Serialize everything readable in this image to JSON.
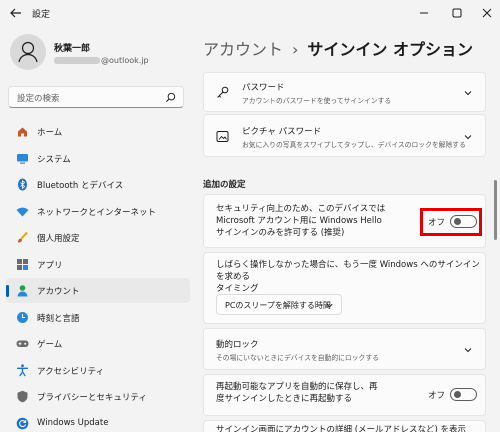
{
  "app": {
    "title": "設定"
  },
  "profile": {
    "name": "秋葉一郎",
    "email_domain": "@outlook.jp"
  },
  "search": {
    "placeholder": "設定の検索"
  },
  "nav": [
    {
      "label": "ホーム",
      "icon": "home-icon"
    },
    {
      "label": "システム",
      "icon": "system-icon"
    },
    {
      "label": "Bluetooth とデバイス",
      "icon": "bluetooth-icon"
    },
    {
      "label": "ネットワークとインターネット",
      "icon": "wifi-icon"
    },
    {
      "label": "個人用設定",
      "icon": "brush-icon"
    },
    {
      "label": "アプリ",
      "icon": "apps-icon"
    },
    {
      "label": "アカウント",
      "icon": "account-icon",
      "selected": true
    },
    {
      "label": "時刻と言語",
      "icon": "clock-globe-icon"
    },
    {
      "label": "ゲーム",
      "icon": "gamepad-icon"
    },
    {
      "label": "アクセシビリティ",
      "icon": "accessibility-icon"
    },
    {
      "label": "プライバシーとセキュリティ",
      "icon": "shield-icon"
    },
    {
      "label": "Windows Update",
      "icon": "update-icon"
    }
  ],
  "breadcrumb": {
    "parent": "アカウント",
    "separator": "›",
    "current": "サインイン オプション"
  },
  "cards": {
    "password": {
      "title": "パスワード",
      "desc": "アカウントのパスワードを使ってサインインする"
    },
    "picture_password": {
      "title": "ピクチャ パスワード",
      "desc": "お気に入りの写真をスワイプしてタップし、デバイスのロックを解除する"
    }
  },
  "additional": {
    "heading": "追加の設定",
    "hello_only": {
      "lines": [
        "セキュリティ向上のため、このデバイスでは",
        "Microsoft アカウント用に Windows Hello",
        "サインインのみを許可する (推奨)"
      ],
      "toggle_label": "オフ"
    },
    "away": {
      "lines": [
        "しばらく操作しなかった場合に、もう一度 Windows へのサインインを求める",
        "タイミング"
      ],
      "dropdown_value": "PCのスリープを解除する時間"
    },
    "dynamic_lock": {
      "title": "動的ロック",
      "desc": "その場にいないときにデバイスを自動的にロックする"
    },
    "restart_apps": {
      "lines": [
        "再起動可能なアプリを自動的に保存し、再",
        "度サインインしたときに再起動する"
      ],
      "toggle_label": "オフ"
    },
    "partial": {
      "text": "サインイン画面にアカウントの詳細 (メールアドレスなど) を表示"
    }
  },
  "colors": {
    "accent": "#005fb8",
    "highlight_box": "#e00000"
  }
}
